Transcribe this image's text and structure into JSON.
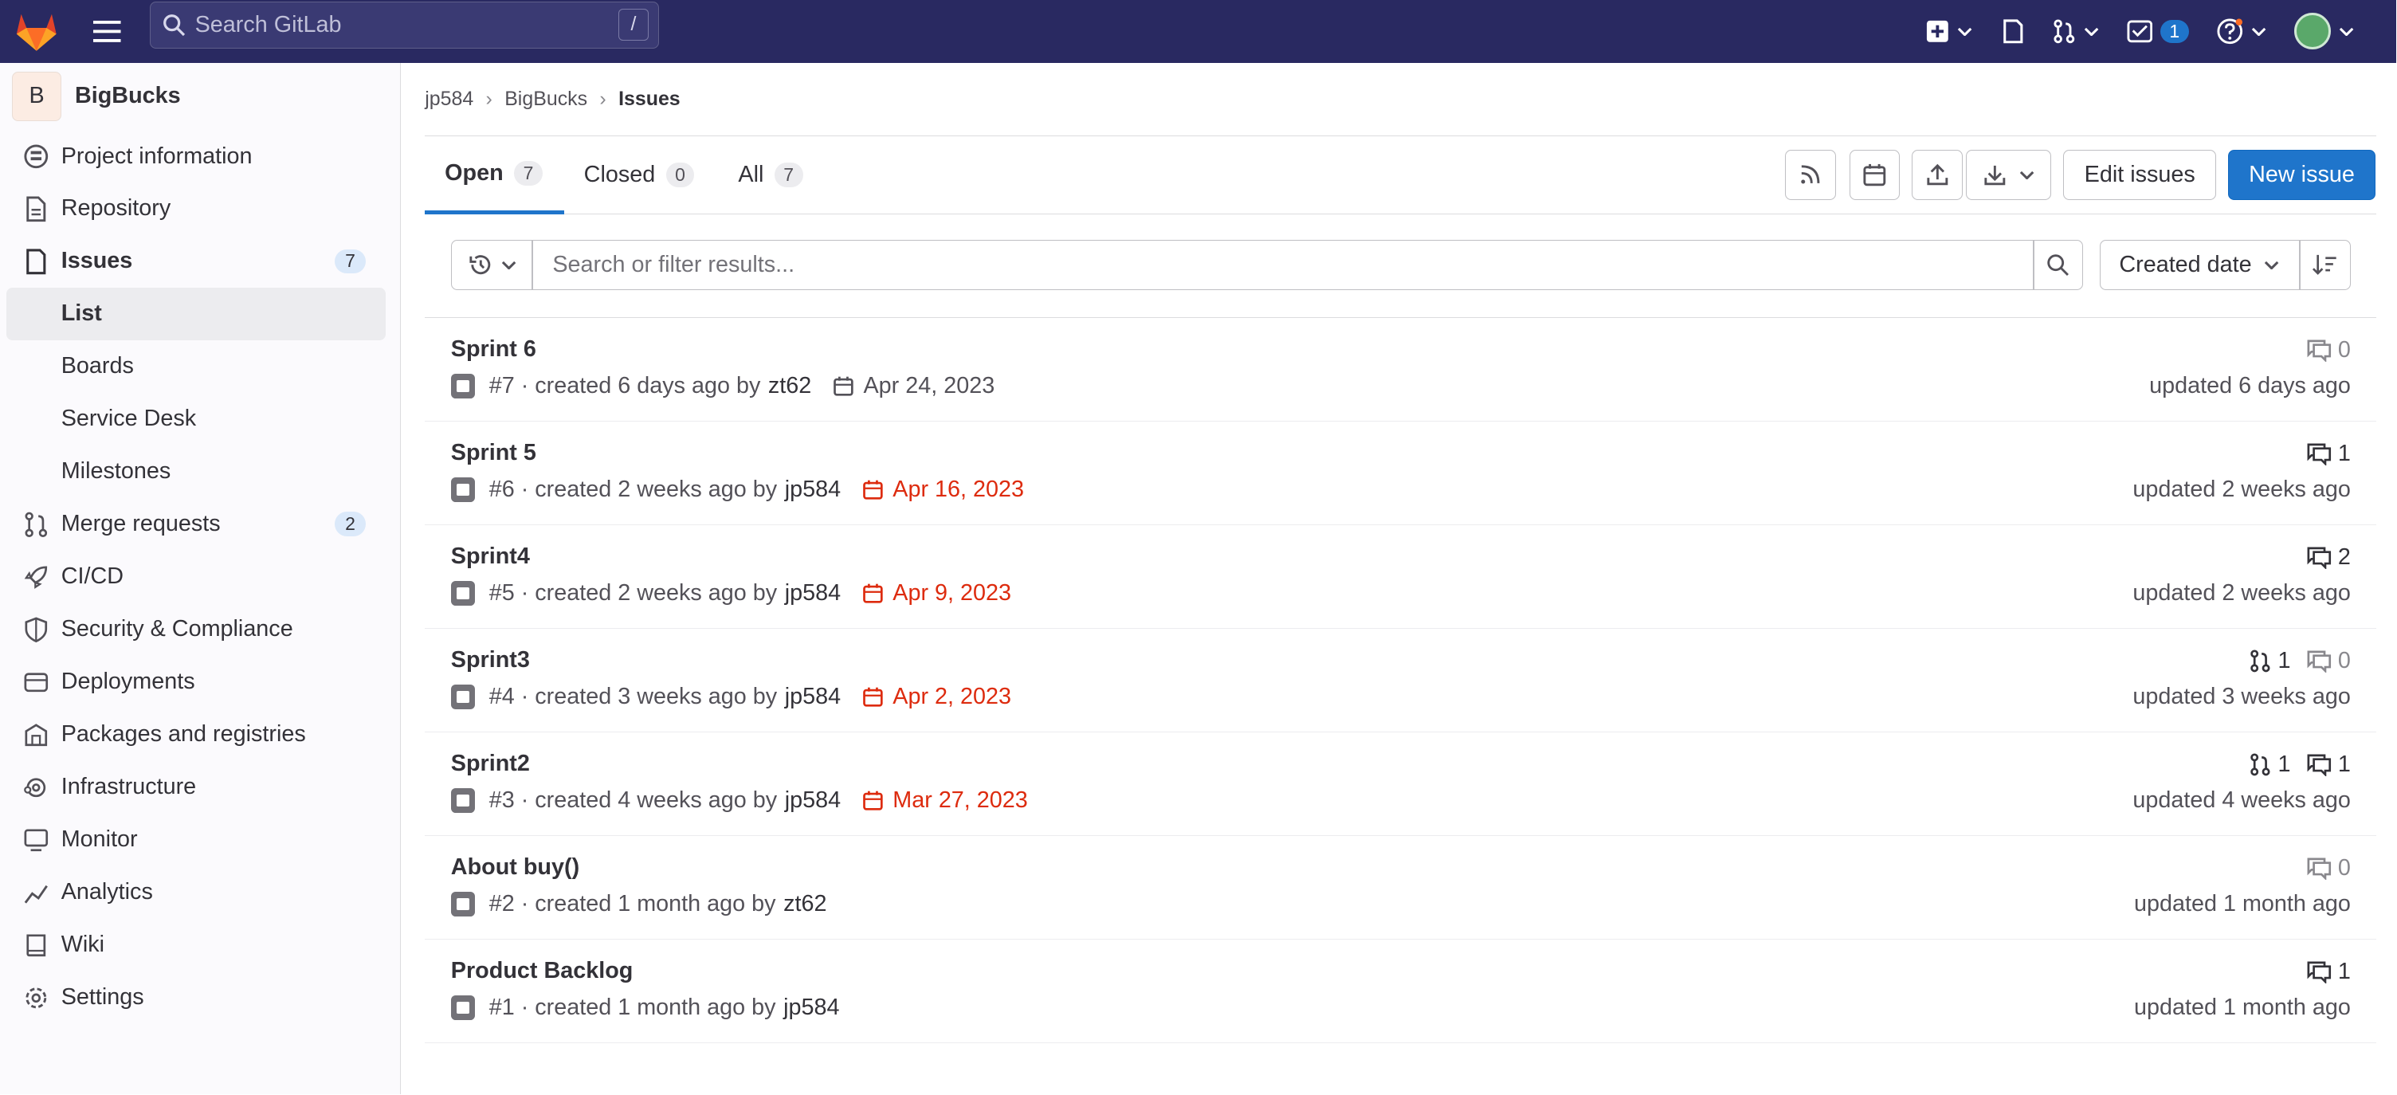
{
  "topbar": {
    "search_placeholder": "Search GitLab",
    "search_shortcut": "/",
    "todo_count": "1"
  },
  "sidebar": {
    "project_initial": "B",
    "project_name": "BigBucks",
    "items": [
      {
        "label": "Project information"
      },
      {
        "label": "Repository"
      },
      {
        "label": "Issues",
        "count": "7"
      },
      {
        "label": "List"
      },
      {
        "label": "Boards"
      },
      {
        "label": "Service Desk"
      },
      {
        "label": "Milestones"
      },
      {
        "label": "Merge requests",
        "count": "2"
      },
      {
        "label": "CI/CD"
      },
      {
        "label": "Security & Compliance"
      },
      {
        "label": "Deployments"
      },
      {
        "label": "Packages and registries"
      },
      {
        "label": "Infrastructure"
      },
      {
        "label": "Monitor"
      },
      {
        "label": "Analytics"
      },
      {
        "label": "Wiki"
      },
      {
        "label": "Settings"
      }
    ]
  },
  "breadcrumb": {
    "user": "jp584",
    "project": "BigBucks",
    "current": "Issues"
  },
  "tabs": [
    {
      "label": "Open",
      "count": "7"
    },
    {
      "label": "Closed",
      "count": "0"
    },
    {
      "label": "All",
      "count": "7"
    }
  ],
  "actions": {
    "edit_issues": "Edit issues",
    "new_issue": "New issue"
  },
  "filter": {
    "placeholder": "Search or filter results...",
    "sort_label": "Created date"
  },
  "issues": [
    {
      "title": "Sprint 6",
      "meta": "#7 · created 6 days ago by",
      "author": "zt62",
      "due": "Apr 24, 2023",
      "mrs": "",
      "comments": "0",
      "updated": "updated 6 days ago"
    },
    {
      "title": "Sprint 5",
      "meta": "#6 · created 2 weeks ago by",
      "author": "jp584",
      "due": "Apr 16, 2023",
      "mrs": "",
      "comments": "1",
      "updated": "updated 2 weeks ago"
    },
    {
      "title": "Sprint4",
      "meta": "#5 · created 2 weeks ago by",
      "author": "jp584",
      "due": "Apr 9, 2023",
      "mrs": "",
      "comments": "2",
      "updated": "updated 2 weeks ago"
    },
    {
      "title": "Sprint3",
      "meta": "#4 · created 3 weeks ago by",
      "author": "jp584",
      "due": "Apr 2, 2023",
      "mrs": "1",
      "comments": "0",
      "updated": "updated 3 weeks ago"
    },
    {
      "title": "Sprint2",
      "meta": "#3 · created 4 weeks ago by",
      "author": "jp584",
      "due": "Mar 27, 2023",
      "mrs": "1",
      "comments": "1",
      "updated": "updated 4 weeks ago"
    },
    {
      "title": "About buy()",
      "meta": "#2 · created 1 month ago by",
      "author": "zt62",
      "due": "",
      "mrs": "",
      "comments": "0",
      "updated": "updated 1 month ago"
    },
    {
      "title": "Product Backlog",
      "meta": "#1 · created 1 month ago by",
      "author": "jp584",
      "due": "",
      "mrs": "",
      "comments": "1",
      "updated": "updated 1 month ago"
    }
  ],
  "colors": {
    "topbar": "#292961",
    "primary": "#1f75cb",
    "overdue": "#dd2b0e"
  }
}
